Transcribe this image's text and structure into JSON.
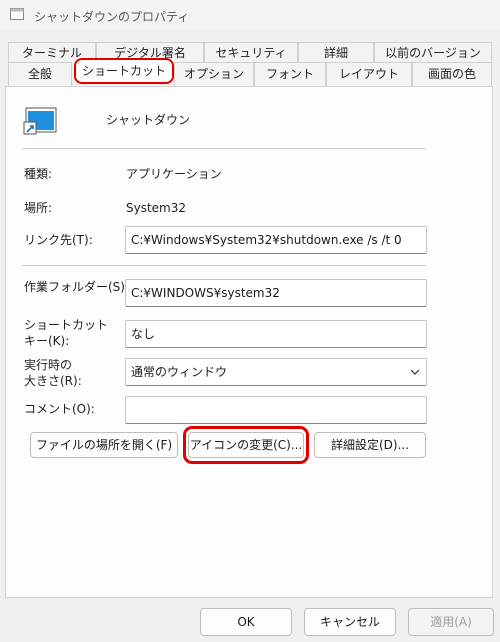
{
  "window": {
    "title": "シャットダウンのプロパティ"
  },
  "tabs_row1": [
    "ターミナル",
    "デジタル署名",
    "セキュリティ",
    "詳細",
    "以前のバージョン"
  ],
  "tabs_row2": [
    "全般",
    "ショートカット",
    "オプション",
    "フォント",
    "レイアウト",
    "画面の色"
  ],
  "selected_tab": "ショートカット",
  "shortcut": {
    "name": "シャットダウン",
    "type_label": "種類:",
    "type_value": "アプリケーション",
    "location_label": "場所:",
    "location_value": "System32",
    "target_label": "リンク先(T):",
    "target_value": "C:¥Windows¥System32¥shutdown.exe /s /t 0",
    "startin_label": "作業フォルダー(S):",
    "startin_value": "C:¥WINDOWS¥system32",
    "hotkey_label_1": "ショートカット",
    "hotkey_label_2": "キー(K):",
    "hotkey_value": "なし",
    "run_label_1": "実行時の",
    "run_label_2": "大きさ(R):",
    "run_value": "通常のウィンドウ",
    "comment_label": "コメント(O):",
    "comment_value": "",
    "open_location_button": "ファイルの場所を開く(F)",
    "change_icon_button": "アイコンの変更(C)...",
    "advanced_button": "詳細設定(D)..."
  },
  "footer": {
    "ok": "OK",
    "cancel": "キャンセル",
    "apply": "適用(A)"
  },
  "colors": {
    "highlight": "#e00000",
    "shortcut_icon": "#1f8fe0"
  }
}
